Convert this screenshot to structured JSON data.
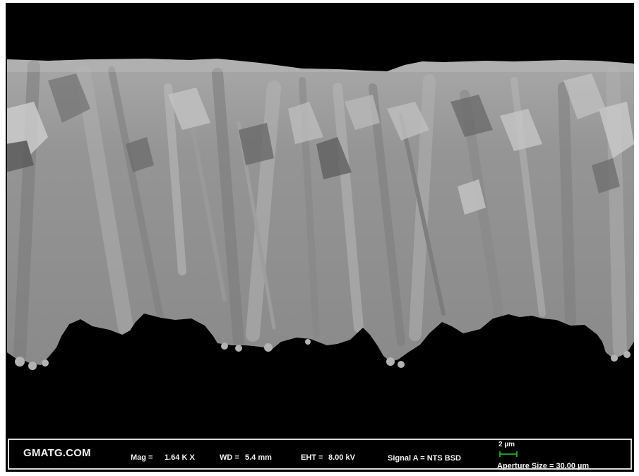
{
  "image": {
    "kind": "scanning electron micrograph (backscatter), cross-section of a columnar metal deposit on black background",
    "colors": {
      "background": "#000000",
      "deposit_base": "#8f8f8f",
      "deposit_light": "#b4b4b4",
      "deposit_dark": "#5e5e5e",
      "scale_bar": "#2fc62f",
      "text": "#f2f2f2"
    }
  },
  "databar": {
    "brand": "GMATG.COM",
    "mag_label": "Mag =",
    "mag_value": "1.64 K X",
    "wd_label": "WD =",
    "wd_value": "5.4 mm",
    "eht_label": "EHT =",
    "eht_value": "8.00 kV",
    "signal": "Signal A = NTS BSD",
    "scale_label": "2 µm",
    "aperture": "Aperture Size = 30.00 µm"
  }
}
